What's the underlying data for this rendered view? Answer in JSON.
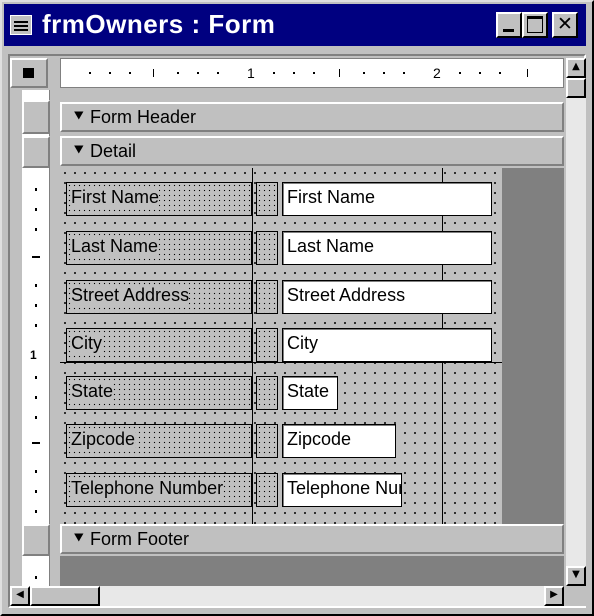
{
  "window": {
    "title": "frmOwners : Form",
    "icon": "form-icon"
  },
  "ruler": {
    "marks": [
      "1",
      "2"
    ],
    "vertical_marks": [
      "1"
    ]
  },
  "sections": {
    "form_header": "Form Header",
    "detail": "Detail",
    "form_footer": "Form Footer"
  },
  "fields": [
    {
      "label": "First Name",
      "control": "First Name"
    },
    {
      "label": "Last Name",
      "control": "Last Name"
    },
    {
      "label": "Street Address",
      "control": "Street Address"
    },
    {
      "label": "City",
      "control": "City"
    },
    {
      "label": "State",
      "control": "State"
    },
    {
      "label": "Zipcode",
      "control": "Zipcode"
    },
    {
      "label": "Telephone Number",
      "control": "Telephone Number"
    }
  ]
}
